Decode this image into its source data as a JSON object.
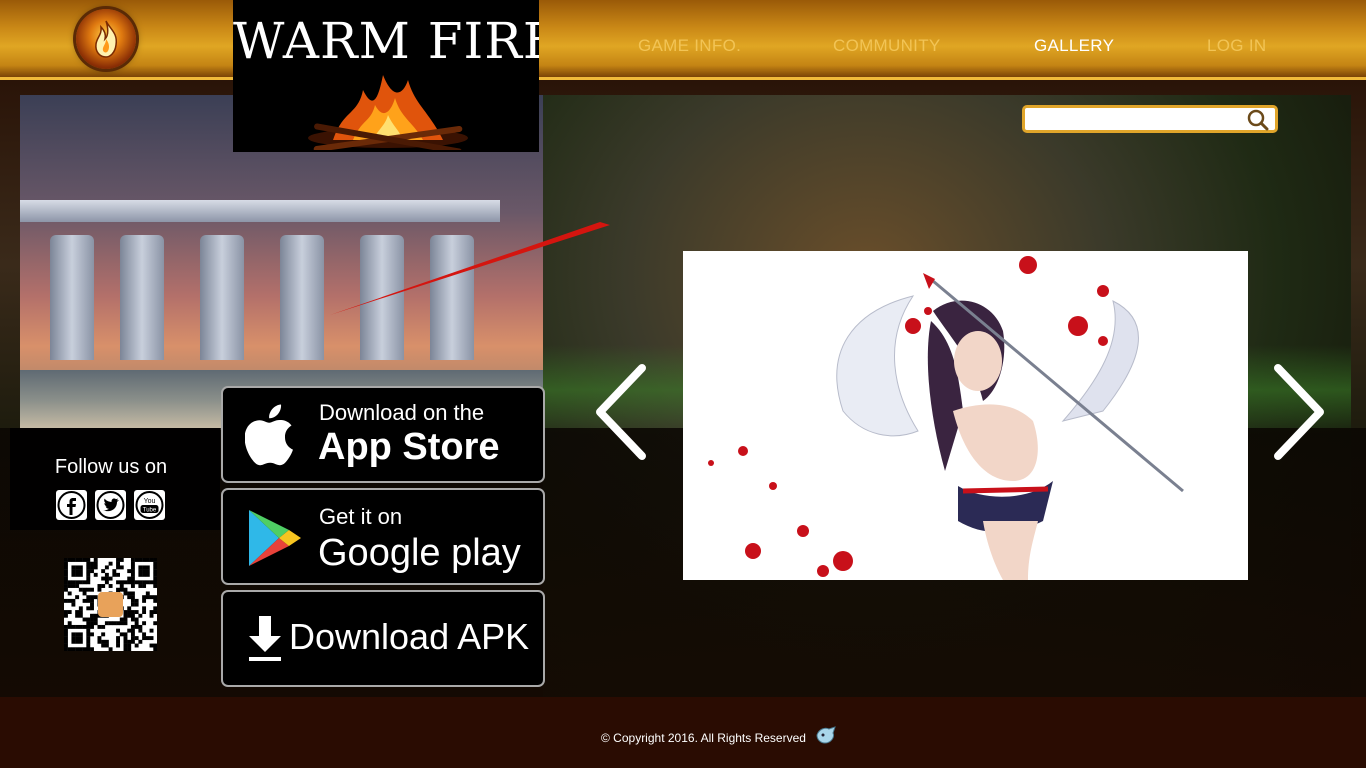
{
  "brand": {
    "title": "WARM FIRE"
  },
  "nav": {
    "items": [
      {
        "label": "GAME INFO."
      },
      {
        "label": "COMMUNITY"
      },
      {
        "label": "GALLERY"
      },
      {
        "label": "LOG IN"
      }
    ],
    "active": "GALLERY"
  },
  "search": {
    "placeholder": "",
    "value": ""
  },
  "follow": {
    "label": "Follow us on",
    "networks": [
      "facebook-icon",
      "twitter-icon",
      "youtube-icon"
    ]
  },
  "stores": {
    "app_store": {
      "line1": "Download on the",
      "line2": "App Store"
    },
    "google_play": {
      "line1": "Get it on",
      "line2": "Google play"
    },
    "apk": {
      "label": "Download APK"
    }
  },
  "footer": {
    "copyright": "© Copyright 2016. All Rights Reserved"
  },
  "colors": {
    "nav_text": "#f2c455",
    "nav_active": "#ffffff",
    "accent": "#e0a52a",
    "footer_bg": "#2a0c02"
  }
}
